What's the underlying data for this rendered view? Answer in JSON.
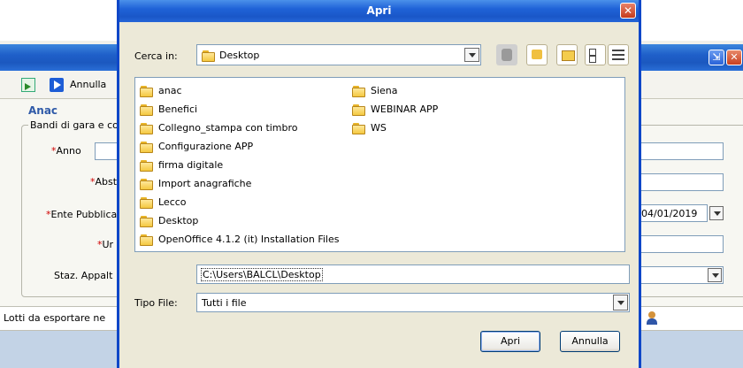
{
  "background_window": {
    "toolbar": {
      "annulla_label": "Annulla"
    },
    "section_title": "Anac",
    "fieldset_legend": "Bandi di gara e co",
    "fields": [
      {
        "label": "Anno",
        "required": true
      },
      {
        "label": "Abst",
        "required": true
      },
      {
        "label": "Ente Pubblica",
        "required": true,
        "value": "04/01/2019"
      },
      {
        "label": "Ur",
        "required": true
      },
      {
        "label": "Staz. Appalt",
        "required": false
      }
    ],
    "status_text": "Lotti da esportare ne",
    "window_buttons": {
      "restore": "⇲",
      "close": "✕"
    }
  },
  "dialog": {
    "title": "Apri",
    "close_glyph": "✕",
    "look_in": {
      "label": "Cerca in:",
      "value": "Desktop"
    },
    "toolbar_icons": [
      "back-icon",
      "up-folder-icon",
      "new-folder-icon",
      "list-view-icon",
      "details-view-icon"
    ],
    "items": [
      {
        "name": "anac"
      },
      {
        "name": "Benefici"
      },
      {
        "name": "Collegno_stampa con timbro"
      },
      {
        "name": "Configurazione APP"
      },
      {
        "name": "firma digitale"
      },
      {
        "name": "Import anagrafiche"
      },
      {
        "name": "Lecco"
      },
      {
        "name": "Desktop"
      },
      {
        "name": "OpenOffice 4.1.2 (it) Installation Files"
      },
      {
        "name": "Siena"
      },
      {
        "name": "WEBINAR APP"
      },
      {
        "name": "WS"
      }
    ],
    "file_name_value": "C:\\Users\\BALCL\\Desktop",
    "file_type": {
      "label": "Tipo File:",
      "value": "Tutti i file"
    },
    "buttons": {
      "open": "Apri",
      "cancel": "Annulla"
    }
  },
  "colors": {
    "titlebar_blue": "#1f62d7",
    "dialog_bg": "#ece9d8",
    "required_marker": "#d00000",
    "section_title": "#2f5aa8"
  }
}
